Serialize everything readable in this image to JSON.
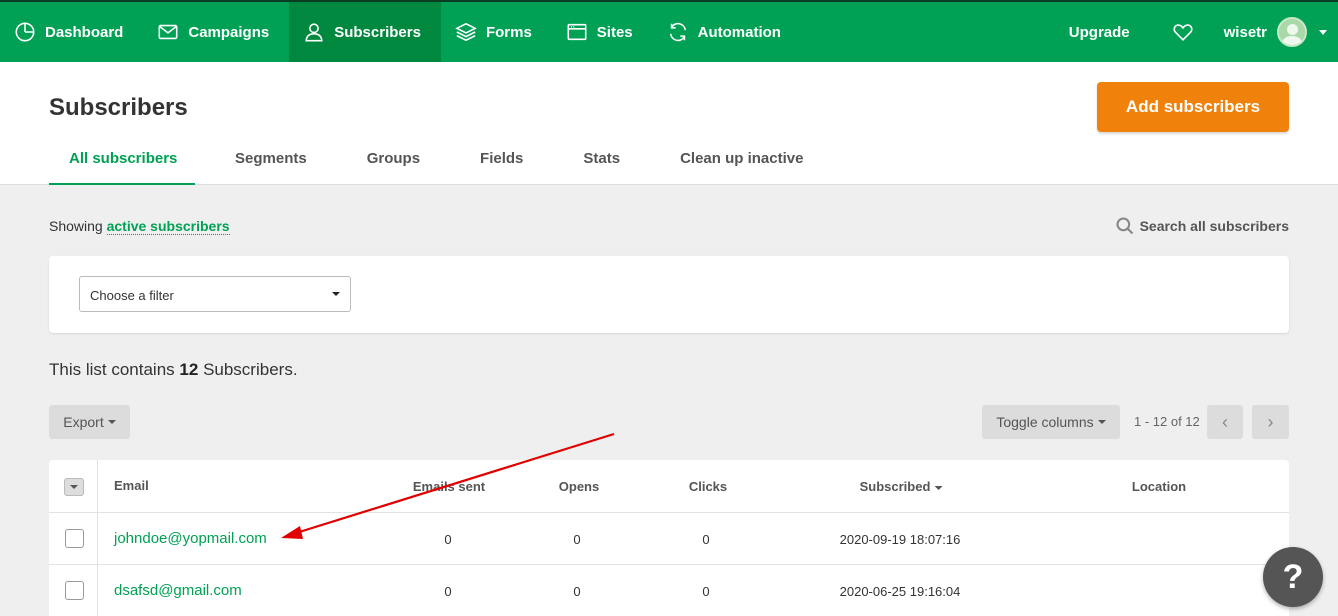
{
  "nav": {
    "items": [
      {
        "label": "Dashboard",
        "icon": "dashboard-icon"
      },
      {
        "label": "Campaigns",
        "icon": "envelope-icon"
      },
      {
        "label": "Subscribers",
        "icon": "user-icon"
      },
      {
        "label": "Forms",
        "icon": "layers-icon"
      },
      {
        "label": "Sites",
        "icon": "browser-window-icon"
      },
      {
        "label": "Automation",
        "icon": "refresh-icon"
      }
    ],
    "active": "Subscribers",
    "upgrade": "Upgrade",
    "username": "wisetr"
  },
  "header": {
    "title": "Subscribers",
    "add_button": "Add subscribers",
    "tabs": [
      "All subscribers",
      "Segments",
      "Groups",
      "Fields",
      "Stats",
      "Clean up inactive"
    ]
  },
  "showing": {
    "prefix": "Showing",
    "link": "active subscribers"
  },
  "search_all": "Search all subscribers",
  "filter": {
    "selected": "Choose a filter"
  },
  "count": {
    "prefix": "This list contains",
    "number": "12",
    "suffix": "Subscribers."
  },
  "toolbar": {
    "export": "Export",
    "toggle_columns": "Toggle columns",
    "pager": "1 - 12 of 12"
  },
  "table": {
    "columns": [
      "Email",
      "Emails sent",
      "Opens",
      "Clicks",
      "Subscribed",
      "Location"
    ],
    "rows": [
      {
        "email": "johndoe@yopmail.com",
        "sent": "0",
        "opens": "0",
        "clicks": "0",
        "subscribed": "2020-09-19 18:07:16",
        "location": ""
      },
      {
        "email": "dsafsd@gmail.com",
        "sent": "0",
        "opens": "0",
        "clicks": "0",
        "subscribed": "2020-06-25 19:16:04",
        "location": ""
      }
    ]
  },
  "help": "?",
  "colors": {
    "brand_green": "#00a154",
    "accent_orange": "#f0820c",
    "annotation_red": "#e00000"
  }
}
